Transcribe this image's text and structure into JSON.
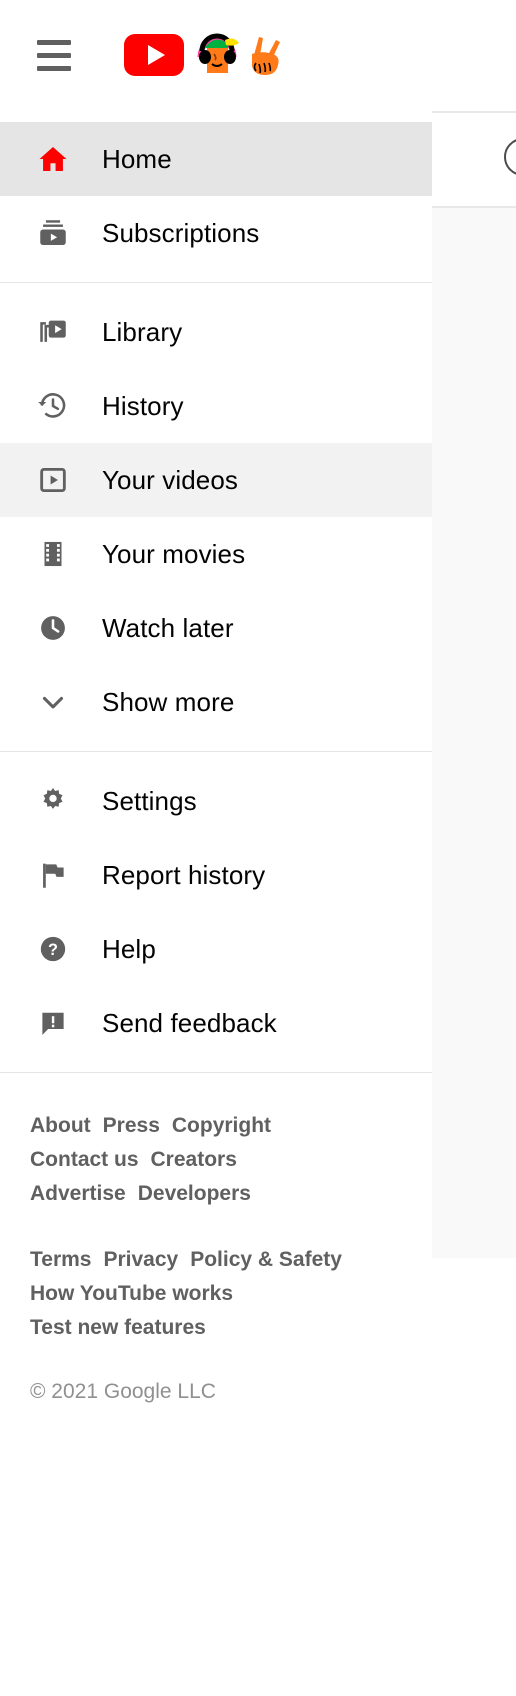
{
  "header": {
    "menu_button": "menu-icon",
    "logo_text": "YouTube",
    "doodle_alt": "doodle-graphic"
  },
  "brand": {
    "red": "#ff0000",
    "icon_gray": "#606060",
    "text_black": "#030303",
    "active_row_bg": "#e5e5e5",
    "hover_row_bg": "#f2f2f2",
    "divider": "#e5e5e5",
    "footer_link": "#606060",
    "copyright_gray": "#909090"
  },
  "sections": [
    {
      "name": "primary",
      "items": [
        {
          "label": "Home",
          "icon": "home-icon",
          "state": "active"
        },
        {
          "label": "Subscriptions",
          "icon": "subscriptions-icon",
          "state": "normal"
        }
      ]
    },
    {
      "name": "library",
      "items": [
        {
          "label": "Library",
          "icon": "library-icon",
          "state": "normal"
        },
        {
          "label": "History",
          "icon": "history-icon",
          "state": "normal"
        },
        {
          "label": "Your videos",
          "icon": "your-videos-icon",
          "state": "hover"
        },
        {
          "label": "Your movies",
          "icon": "film-strip-icon",
          "state": "normal"
        },
        {
          "label": "Watch later",
          "icon": "clock-icon",
          "state": "normal"
        },
        {
          "label": "Show more",
          "icon": "chevron-down-icon",
          "state": "normal"
        }
      ]
    },
    {
      "name": "settings",
      "items": [
        {
          "label": "Settings",
          "icon": "gear-icon",
          "state": "normal"
        },
        {
          "label": "Report history",
          "icon": "flag-icon",
          "state": "normal"
        },
        {
          "label": "Help",
          "icon": "help-icon",
          "state": "normal"
        },
        {
          "label": "Send feedback",
          "icon": "feedback-icon",
          "state": "normal"
        }
      ]
    }
  ],
  "footer": {
    "group_one": [
      [
        "About",
        "Press",
        "Copyright"
      ],
      [
        "Contact us",
        "Creators"
      ],
      [
        "Advertise",
        "Developers"
      ]
    ],
    "group_two": [
      [
        "Terms",
        "Privacy",
        "Policy & Safety"
      ],
      [
        "How YouTube works"
      ],
      [
        "Test new features"
      ]
    ],
    "copyright": "© 2021 Google LLC"
  }
}
